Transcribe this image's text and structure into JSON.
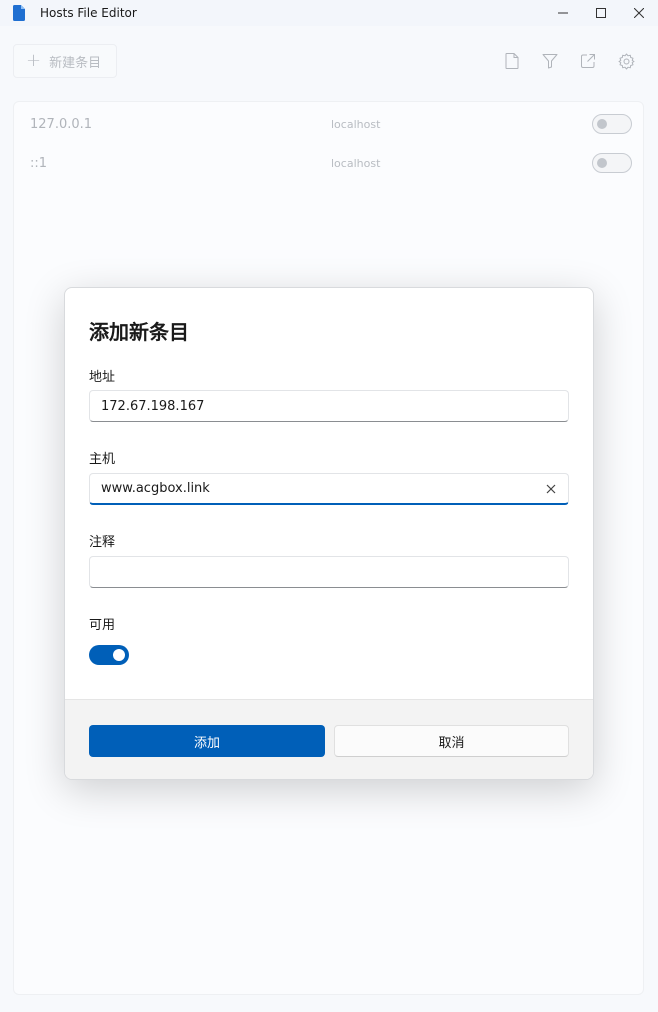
{
  "window": {
    "title": "Hosts File Editor"
  },
  "toolbar": {
    "new_entry_label": "新建条目",
    "icons": [
      "file-icon",
      "filter-icon",
      "open-external-icon",
      "settings-icon"
    ]
  },
  "entries": [
    {
      "address": "127.0.0.1",
      "host": "localhost",
      "enabled": false
    },
    {
      "address": "::1",
      "host": "localhost",
      "enabled": false
    }
  ],
  "dialog": {
    "title": "添加新条目",
    "address_label": "地址",
    "address_value": "172.67.198.167",
    "host_label": "主机",
    "host_value": "www.acgbox.link",
    "comment_label": "注释",
    "comment_value": "",
    "enabled_label": "可用",
    "enabled": true,
    "add_label": "添加",
    "cancel_label": "取消"
  },
  "colors": {
    "accent": "#005fb8",
    "app_icon": "#1f6fd1"
  }
}
